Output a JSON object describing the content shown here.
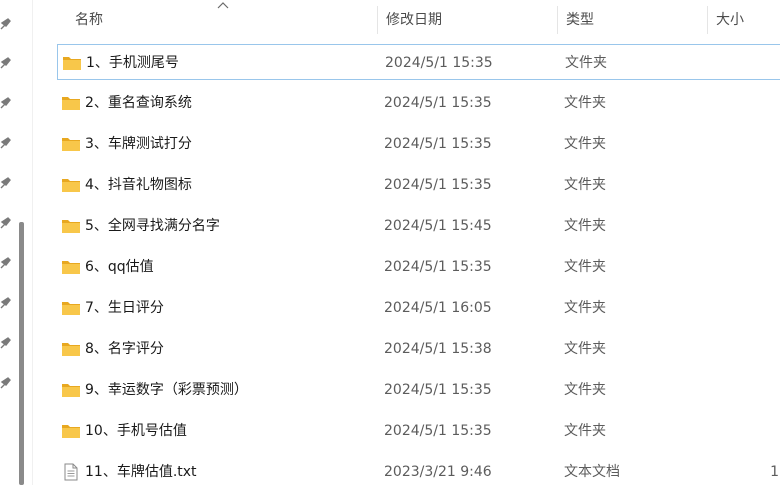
{
  "columns": {
    "name": "名称",
    "date": "修改日期",
    "type": "类型",
    "size": "大小"
  },
  "files": [
    {
      "name": "1、手机测尾号",
      "date": "2024/5/1 15:35",
      "type": "文件夹",
      "size": "",
      "icon": "folder-icon",
      "selected": true
    },
    {
      "name": "2、重名查询系统",
      "date": "2024/5/1 15:35",
      "type": "文件夹",
      "size": "",
      "icon": "folder-icon"
    },
    {
      "name": "3、车牌测试打分",
      "date": "2024/5/1 15:35",
      "type": "文件夹",
      "size": "",
      "icon": "folder-icon"
    },
    {
      "name": "4、抖音礼物图标",
      "date": "2024/5/1 15:35",
      "type": "文件夹",
      "size": "",
      "icon": "folder-icon"
    },
    {
      "name": "5、全网寻找满分名字",
      "date": "2024/5/1 15:45",
      "type": "文件夹",
      "size": "",
      "icon": "folder-icon"
    },
    {
      "name": "6、qq估值",
      "date": "2024/5/1 15:35",
      "type": "文件夹",
      "size": "",
      "icon": "folder-icon"
    },
    {
      "name": "7、生日评分",
      "date": "2024/5/1 16:05",
      "type": "文件夹",
      "size": "",
      "icon": "folder-icon"
    },
    {
      "name": "8、名字评分",
      "date": "2024/5/1 15:38",
      "type": "文件夹",
      "size": "",
      "icon": "folder-icon"
    },
    {
      "name": "9、幸运数字（彩票预测）",
      "date": "2024/5/1 15:35",
      "type": "文件夹",
      "size": "",
      "icon": "folder-icon"
    },
    {
      "name": "10、手机号估值",
      "date": "2024/5/1 15:35",
      "type": "文件夹",
      "size": "",
      "icon": "folder-icon"
    },
    {
      "name": "11、车牌估值.txt",
      "date": "2023/3/21 9:46",
      "type": "文本文档",
      "size": "1",
      "icon": "text-file-icon"
    }
  ],
  "colors": {
    "folder_front": "#f8c74a",
    "folder_back": "#e8a820",
    "selected_border": "#99c6eb",
    "header_text": "#4c4c4c"
  }
}
